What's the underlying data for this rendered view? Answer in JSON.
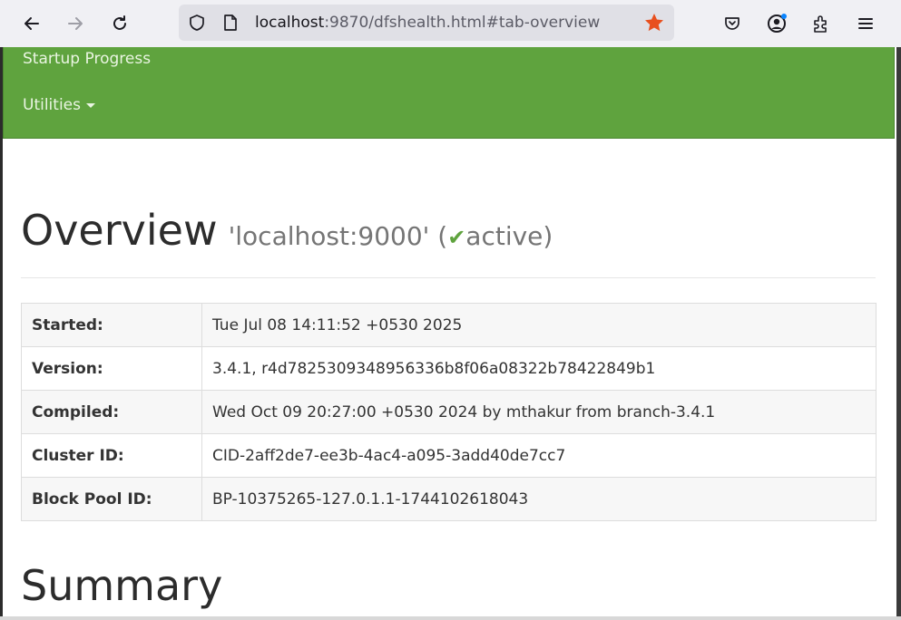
{
  "browser": {
    "url_host": "localhost",
    "url_rest": ":9870/dfshealth.html#tab-overview"
  },
  "navbar": {
    "items": [
      {
        "label": "Startup Progress"
      },
      {
        "label": "Utilities"
      }
    ]
  },
  "overview": {
    "title": "Overview",
    "host": "'localhost:9000' (",
    "status": "active",
    "close": ")",
    "rows": [
      {
        "label": "Started:",
        "value": "Tue Jul 08 14:11:52 +0530 2025"
      },
      {
        "label": "Version:",
        "value": "3.4.1, r4d7825309348956336b8f06a08322b78422849b1"
      },
      {
        "label": "Compiled:",
        "value": "Wed Oct 09 20:27:00 +0530 2024 by mthakur from branch-3.4.1"
      },
      {
        "label": "Cluster ID:",
        "value": "CID-2aff2de7-ee3b-4ac4-a095-3add40de7cc7"
      },
      {
        "label": "Block Pool ID:",
        "value": "BP-10375265-127.0.1.1-1744102618043"
      }
    ]
  },
  "summary": {
    "title": "Summary"
  },
  "colors": {
    "navbar_green": "#5fa33e",
    "star": "#e8501e"
  },
  "icons": [
    "back-icon",
    "forward-icon",
    "reload-icon",
    "shield-icon",
    "page-icon",
    "bookmark-star-icon",
    "pocket-icon",
    "account-icon",
    "extensions-icon",
    "menu-icon",
    "caret-down-icon",
    "check-icon"
  ]
}
